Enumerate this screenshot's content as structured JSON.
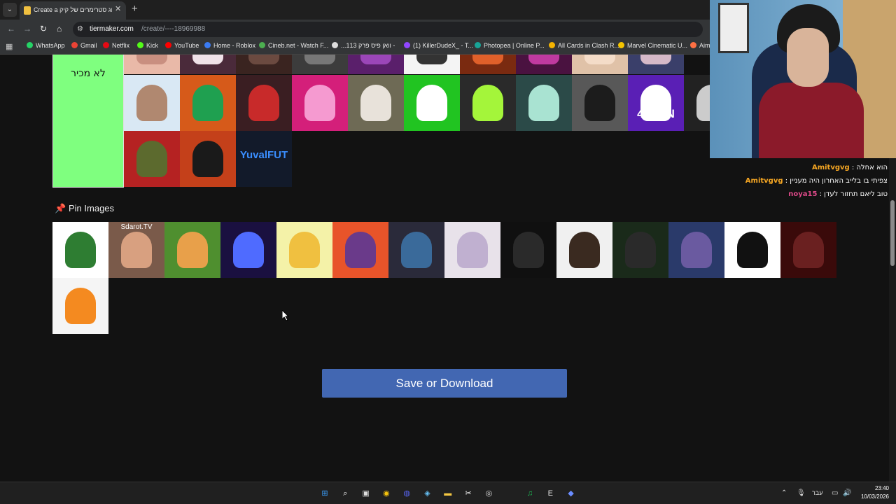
{
  "browser": {
    "tab_title": "Create a דירוג סטרימרים של קיק",
    "tab_list_glyph": "⌄",
    "close_glyph": "✕",
    "new_tab_glyph": "+",
    "url_host": "tiermaker.com",
    "url_path": "/create/----18969988",
    "bookmarks": [
      {
        "label": "WhatsApp",
        "color": "#25d366"
      },
      {
        "label": "Gmail",
        "color": "#ea4335"
      },
      {
        "label": "Netflix",
        "color": "#e50914"
      },
      {
        "label": "Kick",
        "color": "#53fc18"
      },
      {
        "label": "YouTube",
        "color": "#ff0000"
      },
      {
        "label": "Home - Roblox",
        "color": "#3a7bf2"
      },
      {
        "label": "Cineb.net - Watch F...",
        "color": "#4caf50"
      },
      {
        "label": "...וואן פיס פרק 113 -",
        "color": "#dddddd"
      },
      {
        "label": "(1) KillerDudeX_ - T...",
        "color": "#9146ff"
      },
      {
        "label": "Photopea | Online P...",
        "color": "#18a497"
      },
      {
        "label": "All Cards in Clash R...",
        "color": "#f5b400"
      },
      {
        "label": "Marvel Cinematic U...",
        "color": "#f5c400"
      },
      {
        "label": "Aim",
        "color": "#ff7043"
      }
    ]
  },
  "tier": {
    "label": "לא מכיר",
    "color": "#7fff7f"
  },
  "tier_tiles": [
    {
      "bg": "#e9b9a8",
      "fg": "#c98f80",
      "text": ""
    },
    {
      "bg": "#4a2a3a",
      "fg": "#efe2e8",
      "text": ""
    },
    {
      "bg": "#3a2420",
      "fg": "#6b4a40",
      "text": ""
    },
    {
      "bg": "#3c3c3c",
      "fg": "#777777",
      "text": ""
    },
    {
      "bg": "#5a1f6b",
      "fg": "#9b46b8",
      "text": ""
    },
    {
      "bg": "#f4f4f4",
      "fg": "#333333",
      "text": ""
    },
    {
      "bg": "#7a2a10",
      "fg": "#e0602a",
      "text": ""
    },
    {
      "bg": "#4a1240",
      "fg": "#c03aa0",
      "text": ""
    },
    {
      "bg": "#e0c2a8",
      "fg": "#f4dcc8",
      "text": ""
    },
    {
      "bg": "#3a3f6a",
      "fg": "#d6b9c8",
      "text": ""
    },
    {
      "bg": "#d9e8f4",
      "fg": "#b08870",
      "text": ""
    },
    {
      "bg": "#d65a1a",
      "fg": "#1fa050",
      "text": ""
    },
    {
      "bg": "#3a1e22",
      "fg": "#c82a2a",
      "text": ""
    },
    {
      "bg": "#d41f7a",
      "fg": "#f59ad0",
      "text": ""
    },
    {
      "bg": "#6e6a55",
      "fg": "#e8e2da",
      "text": ""
    },
    {
      "bg": "#21c421",
      "fg": "#ffffff",
      "text": ""
    },
    {
      "bg": "#2a2a2a",
      "fg": "#a4f53a",
      "text": ""
    },
    {
      "bg": "#2b4a48",
      "fg": "#a9e3d2",
      "text": ""
    },
    {
      "bg": "#585858",
      "fg": "#1c1c1c",
      "text": ""
    },
    {
      "bg": "#5a1fb5",
      "fg": "#ffffff",
      "text": "4LLEN"
    },
    {
      "bg": "#222222",
      "fg": "#cccccc",
      "text": ""
    },
    {
      "bg": "#b52222",
      "fg": "#5c6a2e",
      "text": ""
    },
    {
      "bg": "#c4401a",
      "fg": "#1a1a1a",
      "text": ""
    },
    {
      "bg": "#121a2a",
      "fg": "#121a2a",
      "text": "YuvalFUT"
    }
  ],
  "pin_section": {
    "title": "Pin Images",
    "icon": "📌",
    "images": [
      {
        "bg": "#ffffff",
        "fg": "#2e7d32",
        "text": ""
      },
      {
        "bg": "#7a5a4a",
        "fg": "#d8a080",
        "text": "Sdarot.TV"
      },
      {
        "bg": "#4f8f2f",
        "fg": "#e8a04a",
        "text": ""
      },
      {
        "bg": "#1a1040",
        "fg": "#4f6bff",
        "text": ""
      },
      {
        "bg": "#f4f2a8",
        "fg": "#f0c040",
        "text": ""
      },
      {
        "bg": "#e8542a",
        "fg": "#6a3a8a",
        "text": ""
      },
      {
        "bg": "#2a2a3a",
        "fg": "#3a6a9a",
        "text": ""
      },
      {
        "bg": "#e8e2ea",
        "fg": "#c0b0d0",
        "text": ""
      },
      {
        "bg": "#101010",
        "fg": "#2a2a2a",
        "text": ""
      },
      {
        "bg": "#f0f0f0",
        "fg": "#3a2a20",
        "text": ""
      },
      {
        "bg": "#1a2a1a",
        "fg": "#2a2a2a",
        "text": ""
      },
      {
        "bg": "#2a3a6a",
        "fg": "#6a5aa0",
        "text": ""
      },
      {
        "bg": "#ffffff",
        "fg": "#111111",
        "text": ""
      },
      {
        "bg": "#3a0a0a",
        "fg": "#6a2020",
        "text": ""
      },
      {
        "bg": "#f5f5f5",
        "fg": "#f48a20",
        "text": ""
      }
    ]
  },
  "save_button": {
    "label": "Save or Download"
  },
  "chat": [
    {
      "user": "Amitvgvg",
      "message": "הוא אחלה",
      "color": "#f5a623"
    },
    {
      "user": "Amitvgvg",
      "message": "צפיתי בו בלייב האחרון היה מעניין",
      "color": "#f5a623"
    },
    {
      "user": "noya15",
      "message": "טוב ליאם תחזור לעדן",
      "color": "#e04a8a"
    }
  ],
  "taskbar": {
    "time": "23:40",
    "date": "10/03/2026",
    "language": "עבר",
    "icons": [
      {
        "name": "windows-start-icon",
        "glyph": "⊞",
        "color": "#3aa0ff"
      },
      {
        "name": "search-icon",
        "glyph": "⌕",
        "color": "#ffffff"
      },
      {
        "name": "task-view-icon",
        "glyph": "▣",
        "color": "#dddddd"
      },
      {
        "name": "chrome-icon",
        "glyph": "◉",
        "color": "#f4c20d"
      },
      {
        "name": "discord-icon",
        "glyph": "◍",
        "color": "#5865f2"
      },
      {
        "name": "steam-icon",
        "glyph": "◈",
        "color": "#66c0f4"
      },
      {
        "name": "file-explorer-icon",
        "glyph": "▬",
        "color": "#f5c842"
      },
      {
        "name": "capcut-icon",
        "glyph": "✂",
        "color": "#ffffff"
      },
      {
        "name": "obs-icon",
        "glyph": "◎",
        "color": "#dddddd"
      },
      {
        "name": "blank-app-icon",
        "glyph": "",
        "color": "#333333"
      },
      {
        "name": "spotify-icon",
        "glyph": "♫",
        "color": "#1db954"
      },
      {
        "name": "epic-games-icon",
        "glyph": "E",
        "color": "#dddddd"
      },
      {
        "name": "app-diamond-icon",
        "glyph": "◆",
        "color": "#6a8cff"
      }
    ]
  }
}
